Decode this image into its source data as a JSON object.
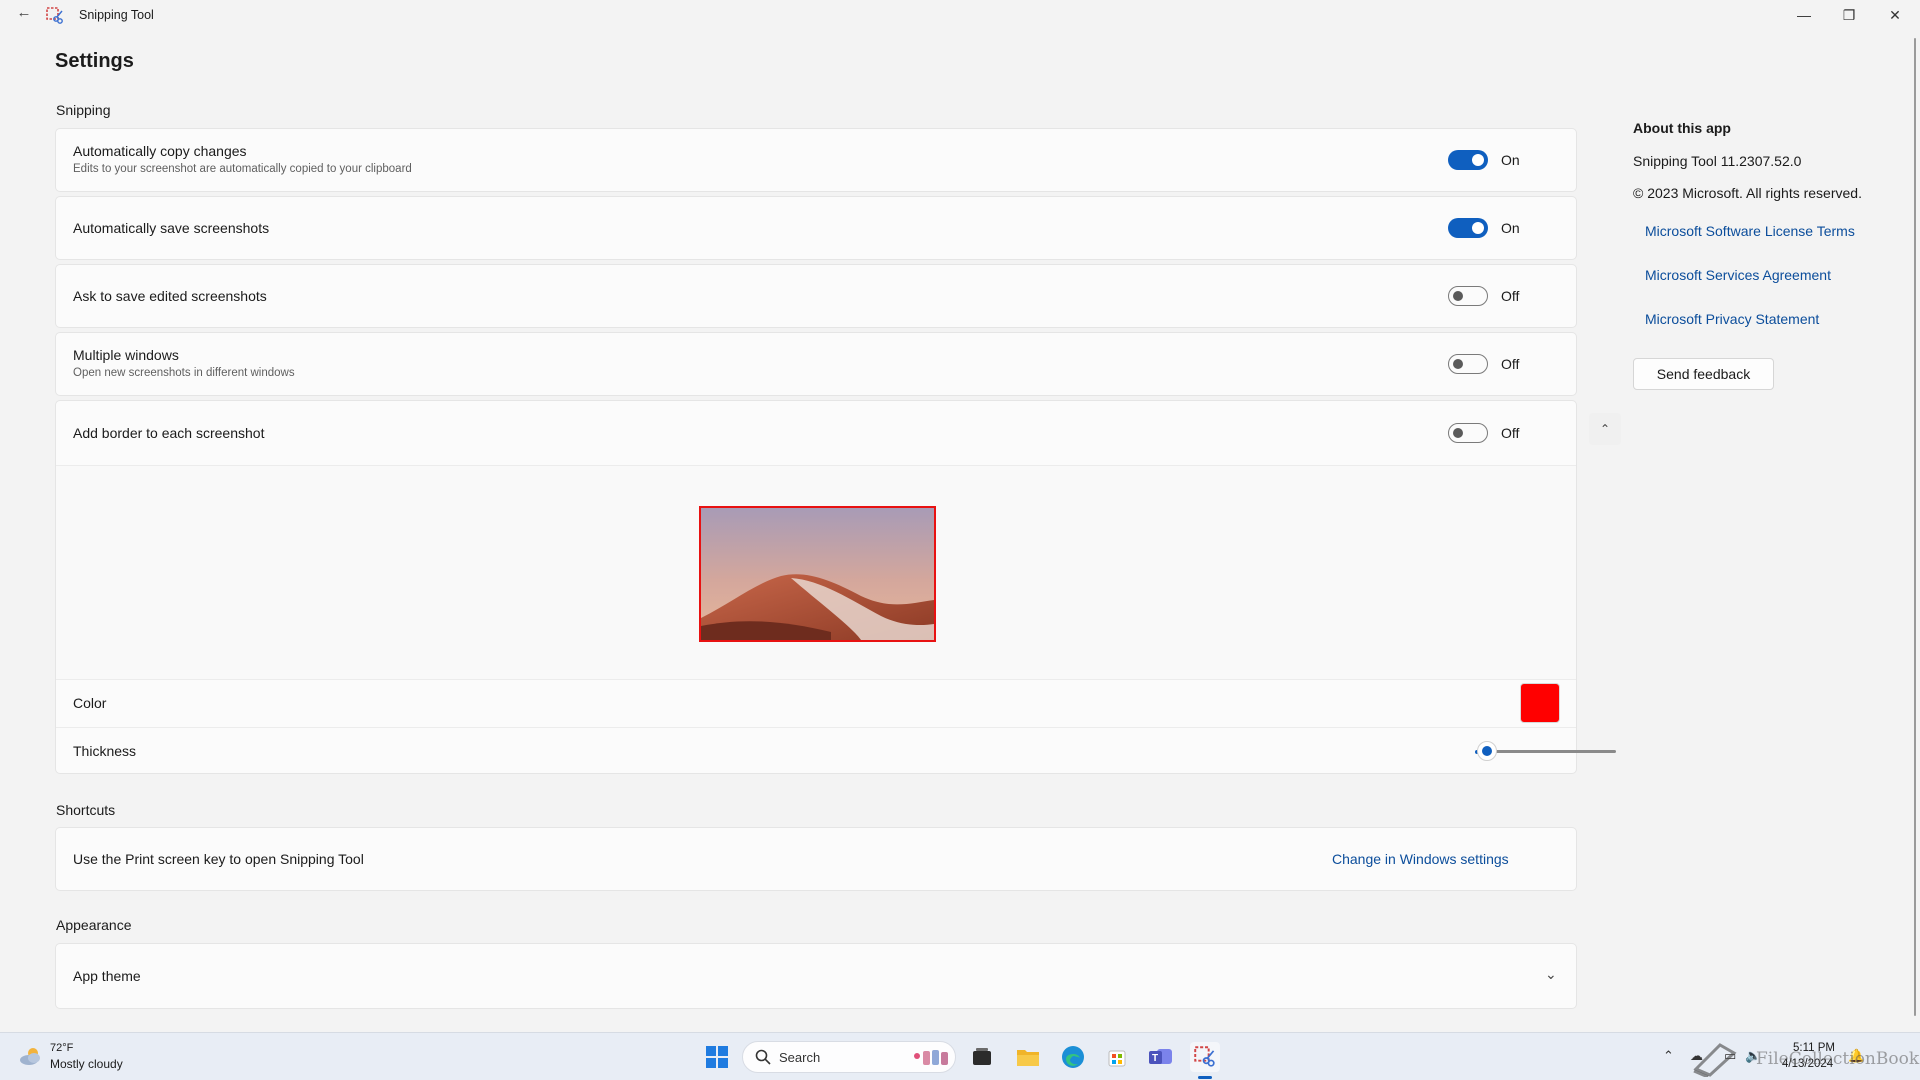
{
  "window": {
    "title": "Snipping Tool",
    "back_glyph": "←",
    "minimize_glyph": "—",
    "maximize_glyph": "❐",
    "close_glyph": "✕"
  },
  "page": {
    "title": "Settings"
  },
  "snipping": {
    "section_label": "Snipping",
    "auto_copy": {
      "title": "Automatically copy changes",
      "desc": "Edits to your screenshot are automatically copied to your clipboard",
      "state": "On"
    },
    "auto_save": {
      "title": "Automatically save screenshots",
      "state": "On"
    },
    "ask_save": {
      "title": "Ask to save edited screenshots",
      "state": "Off"
    },
    "multi_windows": {
      "title": "Multiple windows",
      "desc": "Open new screenshots in different windows",
      "state": "Off"
    },
    "border": {
      "title": "Add border to each screenshot",
      "state": "Off",
      "chevron_glyph": "⌃",
      "color_label": "Color",
      "color_value": "#ff0000",
      "thickness_label": "Thickness",
      "thickness_value": 0.06
    }
  },
  "shortcuts": {
    "section_label": "Shortcuts",
    "print_screen": {
      "title": "Use the Print screen key to open Snipping Tool",
      "link": "Change in Windows settings"
    }
  },
  "appearance": {
    "section_label": "Appearance",
    "app_theme": {
      "title": "App theme",
      "chevron_glyph": "⌄"
    }
  },
  "about": {
    "heading": "About this app",
    "version": "Snipping Tool 11.2307.52.0",
    "copyright": "© 2023 Microsoft. All rights reserved.",
    "links": [
      "Microsoft Software License Terms",
      "Microsoft Services Agreement",
      "Microsoft Privacy Statement"
    ],
    "feedback_button": "Send feedback"
  },
  "taskbar": {
    "weather_temp": "72°F",
    "weather_desc": "Mostly cloudy",
    "search_label": "Search",
    "time": "5:11 PM",
    "date": "4/13/2024",
    "watermark": "FileCollectionBook"
  },
  "colors": {
    "accent": "#0f5fbf",
    "link": "#0b4d9b",
    "border_red": "#e81212"
  }
}
